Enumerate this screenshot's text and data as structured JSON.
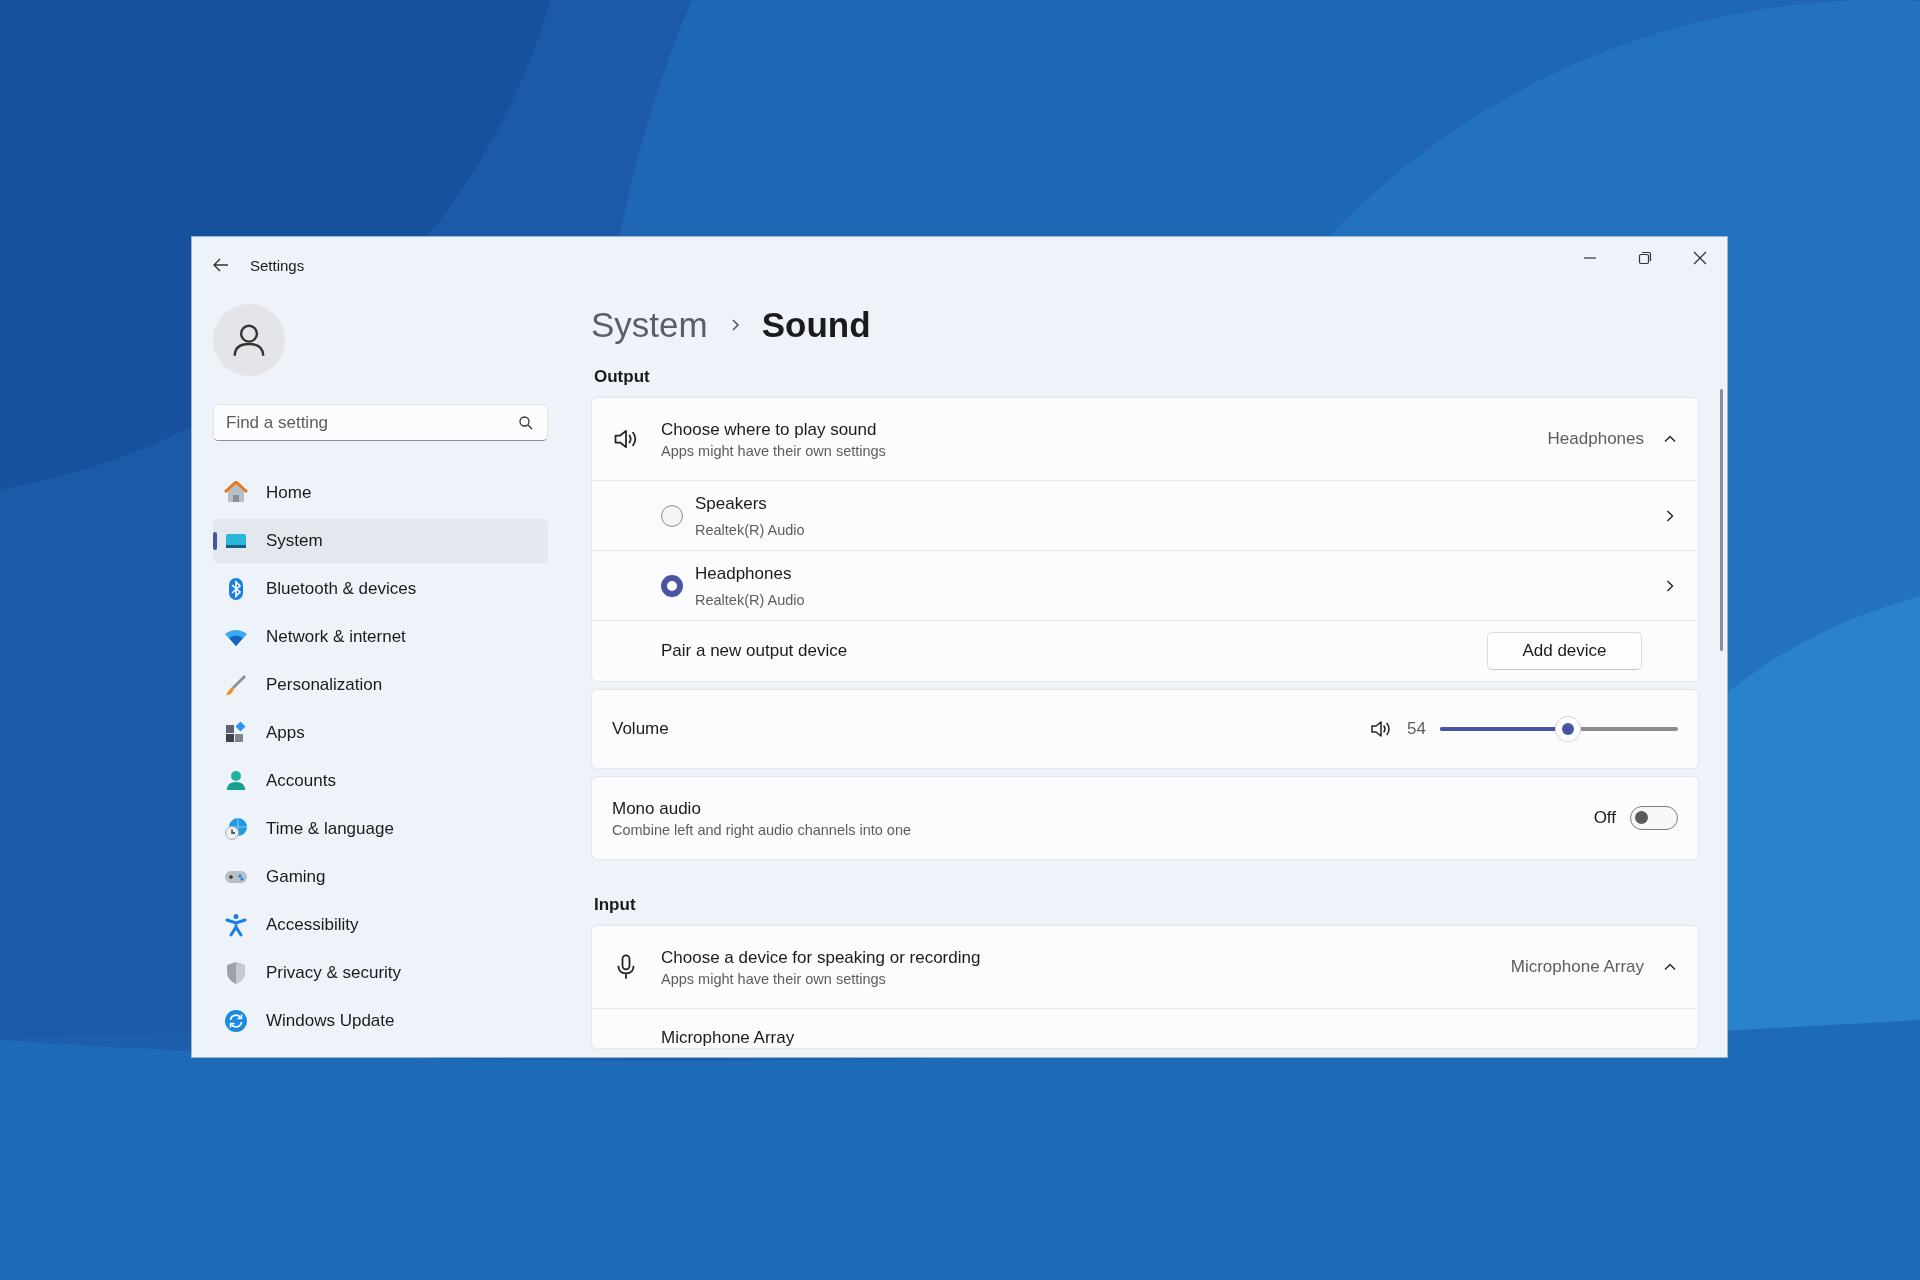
{
  "window": {
    "title": "Settings"
  },
  "sidebar": {
    "search": {
      "placeholder": "Find a setting"
    },
    "items": [
      {
        "label": "Home",
        "kind": "home",
        "selected": false
      },
      {
        "label": "System",
        "kind": "system",
        "selected": true
      },
      {
        "label": "Bluetooth & devices",
        "kind": "bluetooth",
        "selected": false
      },
      {
        "label": "Network & internet",
        "kind": "network",
        "selected": false
      },
      {
        "label": "Personalization",
        "kind": "brush",
        "selected": false
      },
      {
        "label": "Apps",
        "kind": "apps",
        "selected": false
      },
      {
        "label": "Accounts",
        "kind": "accounts",
        "selected": false
      },
      {
        "label": "Time & language",
        "kind": "time",
        "selected": false
      },
      {
        "label": "Gaming",
        "kind": "gaming",
        "selected": false
      },
      {
        "label": "Accessibility",
        "kind": "accessibility",
        "selected": false
      },
      {
        "label": "Privacy & security",
        "kind": "privacy",
        "selected": false
      },
      {
        "label": "Windows Update",
        "kind": "update",
        "selected": false
      }
    ]
  },
  "breadcrumb": [
    "System",
    "Sound"
  ],
  "output": {
    "heading": "Output",
    "chooser": {
      "title": "Choose where to play sound",
      "subtitle": "Apps might have their own settings",
      "value": "Headphones",
      "expanded": true
    },
    "devices": [
      {
        "name": "Speakers",
        "driver": "Realtek(R) Audio",
        "selected": false
      },
      {
        "name": "Headphones",
        "driver": "Realtek(R) Audio",
        "selected": true
      }
    ],
    "pair": {
      "label": "Pair a new output device",
      "button": "Add device"
    },
    "volume": {
      "label": "Volume",
      "reading": "54",
      "level": 0.54
    },
    "mono": {
      "title": "Mono audio",
      "subtitle": "Combine left and right audio channels into one",
      "state_text": "Off",
      "on": false
    }
  },
  "input": {
    "heading": "Input",
    "chooser": {
      "title": "Choose a device for speaking or recording",
      "subtitle": "Apps might have their own settings",
      "value": "Microphone Array",
      "expanded": true
    },
    "devices": [
      {
        "name": "Microphone Array"
      }
    ]
  }
}
